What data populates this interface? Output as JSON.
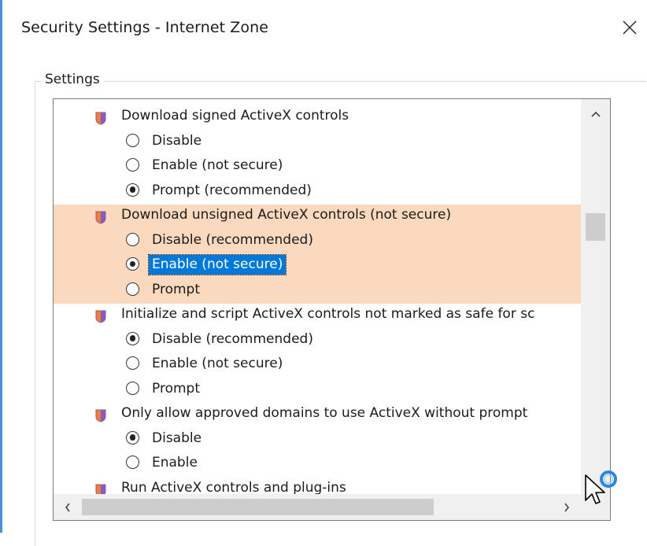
{
  "window": {
    "title": "Security Settings - Internet Zone",
    "close_icon": "close-icon"
  },
  "settings_group": {
    "legend": "Settings"
  },
  "list": {
    "highlight_color": "#fad9be",
    "selection_color": "#0078d7",
    "rows": [
      {
        "kind": "category",
        "label": "Download signed ActiveX controls"
      },
      {
        "kind": "option",
        "label": "Disable",
        "checked": false
      },
      {
        "kind": "option",
        "label": "Enable (not secure)",
        "checked": false
      },
      {
        "kind": "option",
        "label": "Prompt (recommended)",
        "checked": true
      },
      {
        "kind": "category",
        "label": "Download unsigned ActiveX controls (not secure)",
        "highlight": true
      },
      {
        "kind": "option",
        "label": "Disable (recommended)",
        "checked": false,
        "highlight": true
      },
      {
        "kind": "option",
        "label": "Enable (not secure)",
        "checked": true,
        "highlight": true,
        "selected": true
      },
      {
        "kind": "option",
        "label": "Prompt",
        "checked": false,
        "highlight": true
      },
      {
        "kind": "category",
        "label": "Initialize and script ActiveX controls not marked as safe for sc"
      },
      {
        "kind": "option",
        "label": "Disable (recommended)",
        "checked": true
      },
      {
        "kind": "option",
        "label": "Enable (not secure)",
        "checked": false
      },
      {
        "kind": "option",
        "label": "Prompt",
        "checked": false
      },
      {
        "kind": "category",
        "label": "Only allow approved domains to use ActiveX without prompt"
      },
      {
        "kind": "option",
        "label": "Disable",
        "checked": true
      },
      {
        "kind": "option",
        "label": "Enable",
        "checked": false
      },
      {
        "kind": "category",
        "label": "Run ActiveX controls and plug-ins"
      }
    ]
  },
  "scrollbars": {
    "up_icon": "chevron-up-icon",
    "left_icon": "chevron-left-icon",
    "right_icon": "chevron-right-icon"
  }
}
